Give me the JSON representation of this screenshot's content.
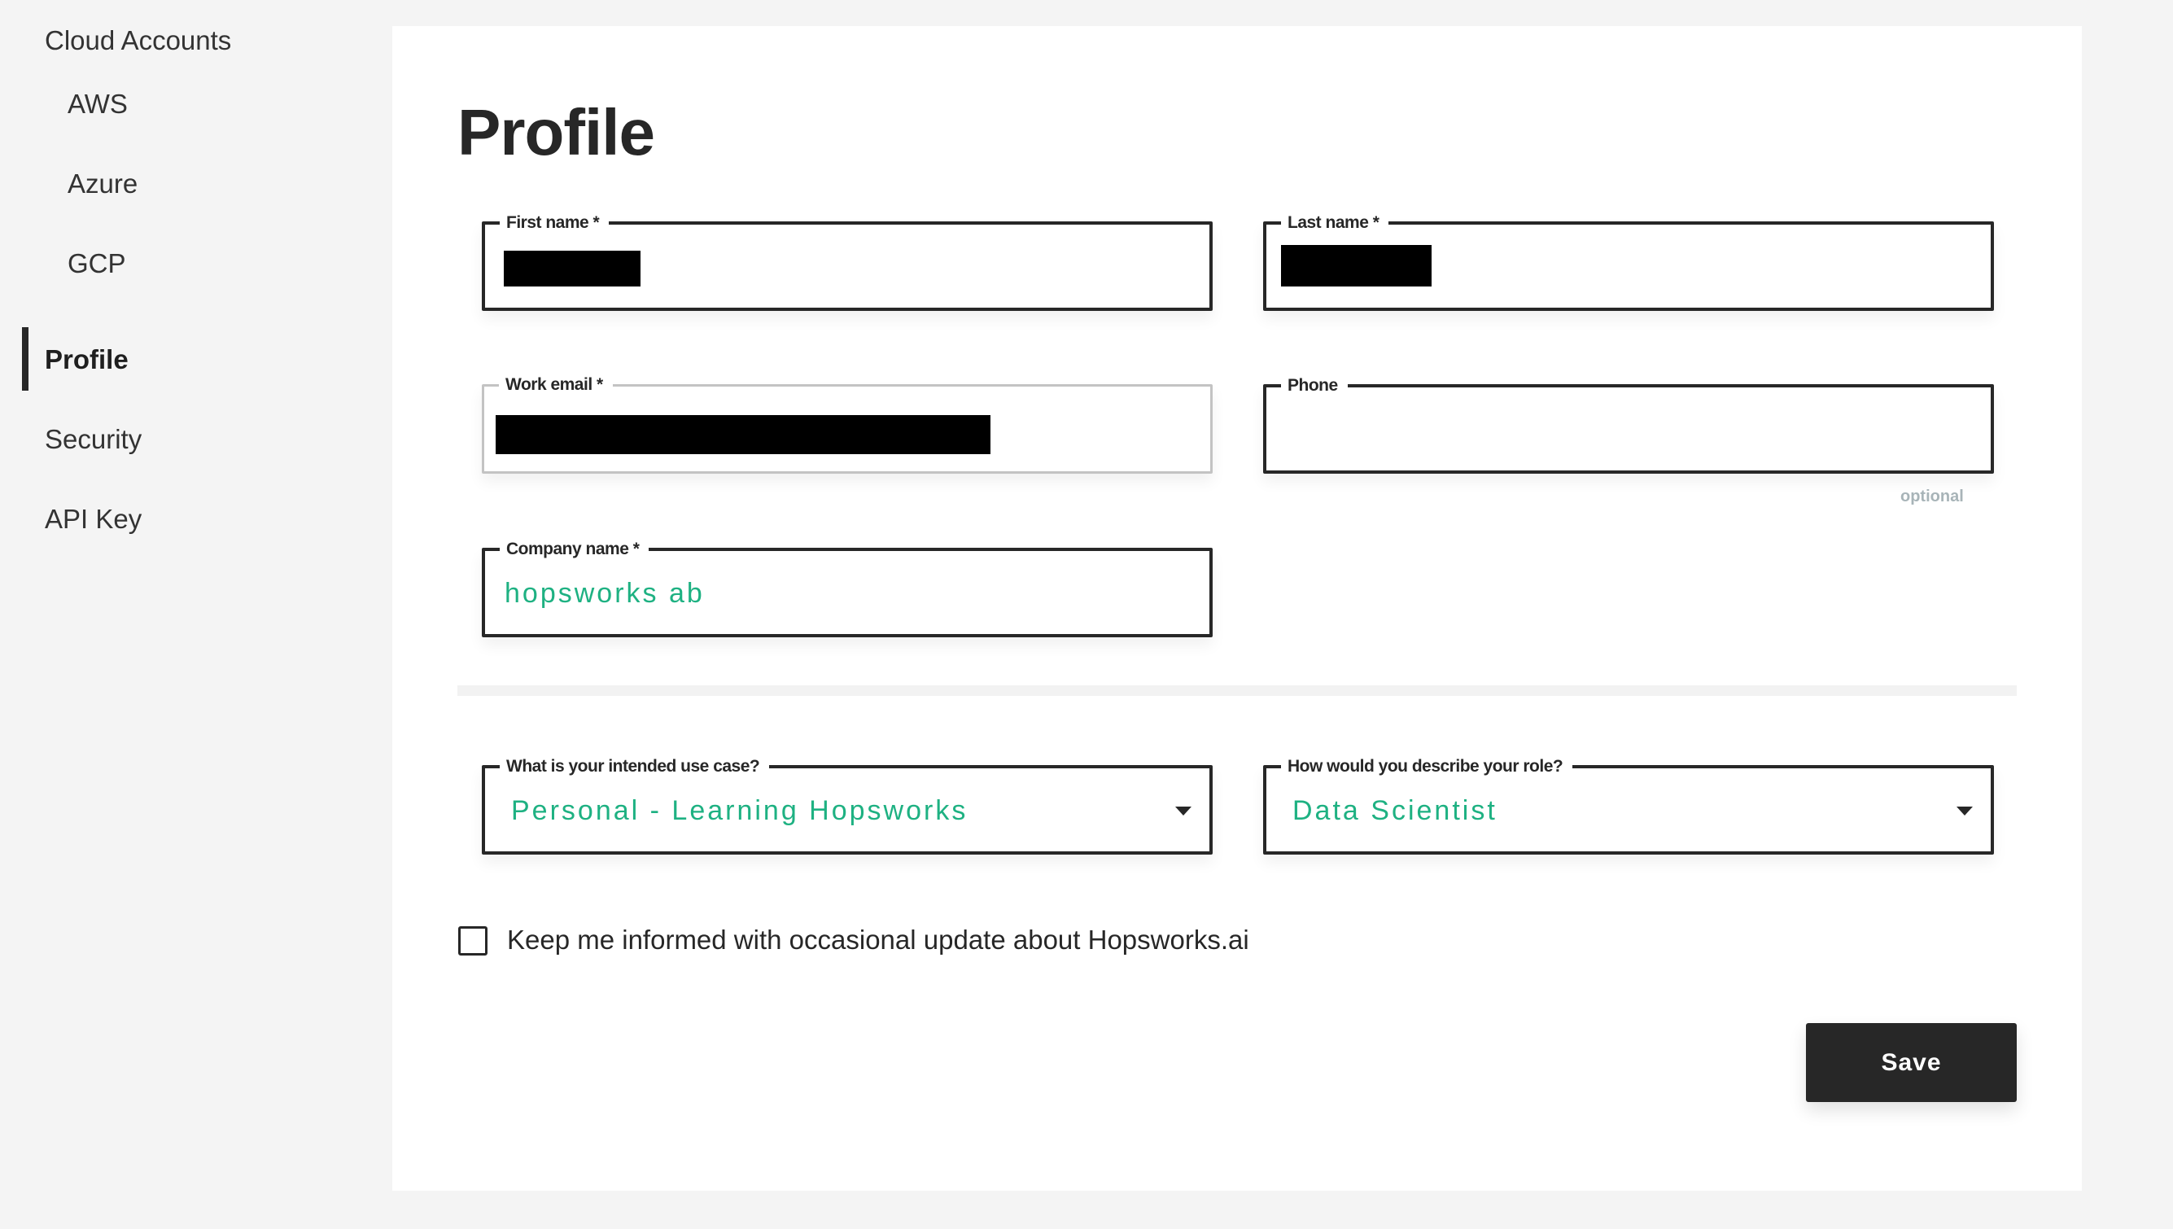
{
  "sidebar": {
    "section_label": "Cloud Accounts",
    "cloud_items": [
      {
        "label": "AWS"
      },
      {
        "label": "Azure"
      },
      {
        "label": "GCP"
      }
    ],
    "items": [
      {
        "label": "Profile",
        "active": true
      },
      {
        "label": "Security",
        "active": false
      },
      {
        "label": "API Key",
        "active": false
      }
    ]
  },
  "page": {
    "title": "Profile"
  },
  "form": {
    "first_name": {
      "label": "First name *",
      "value_redacted": true
    },
    "last_name": {
      "label": "Last name *",
      "value_redacted": true
    },
    "work_email": {
      "label": "Work email *",
      "value_redacted": true,
      "disabled": true
    },
    "phone": {
      "label": "Phone",
      "value": "",
      "hint": "optional"
    },
    "company_name": {
      "label": "Company name *",
      "value": "hopsworks ab"
    },
    "use_case": {
      "label": "What is your intended use case?",
      "selected": "Personal - Learning Hopsworks"
    },
    "role": {
      "label": "How would you describe your role?",
      "selected": "Data Scientist"
    },
    "newsletter": {
      "label": "Keep me informed with occasional update about Hopsworks.ai",
      "checked": false
    },
    "save_label": "Save"
  },
  "colors": {
    "accent": "#1eb182",
    "text": "#272727",
    "background": "#f4f4f4",
    "panel": "#ffffff",
    "button": "#272727"
  }
}
